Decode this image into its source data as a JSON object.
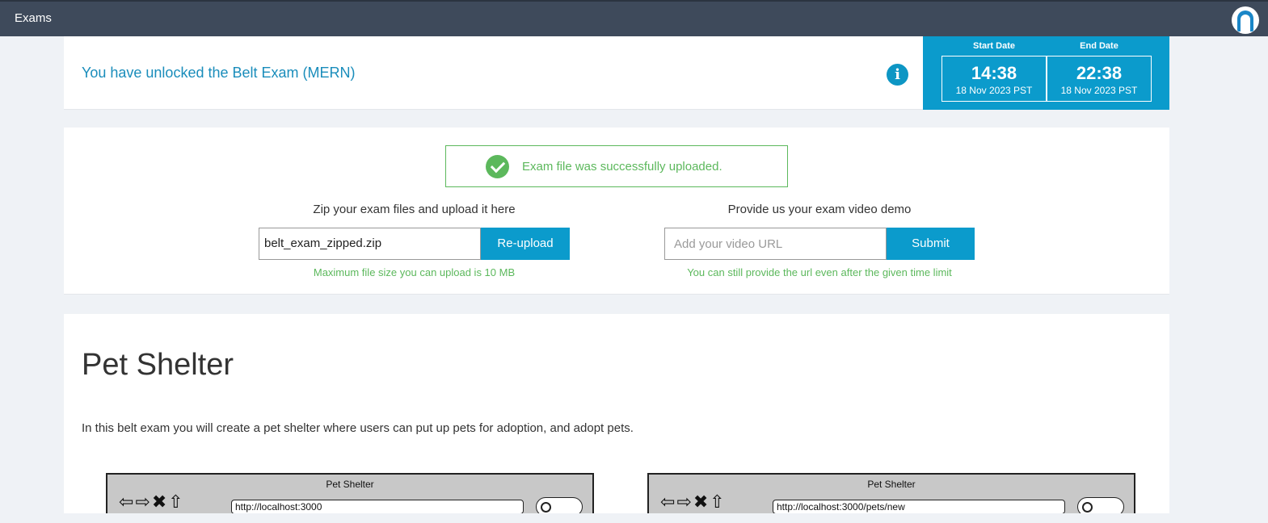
{
  "topbar": {
    "title": "Exams",
    "avatar_icon": "user-avatar-icon"
  },
  "exam": {
    "unlock_text": "You have unlocked the Belt Exam (MERN)",
    "info_icon": "info-icon",
    "start": {
      "label": "Start Date",
      "time": "14:38",
      "date": "18 Nov 2023 PST"
    },
    "end": {
      "label": "End Date",
      "time": "22:38",
      "date": "18 Nov 2023 PST"
    }
  },
  "upload": {
    "success_message": "Exam file was successfully uploaded.",
    "zip_label": "Zip your exam files and upload it here",
    "file_value": "belt_exam_zipped.zip",
    "reupload_label": "Re-upload",
    "file_hint": "Maximum file size you can upload is 10 MB",
    "video_label": "Provide us your exam video demo",
    "video_placeholder": "Add your video URL",
    "submit_label": "Submit",
    "video_hint": "You can still provide the url even after the given time limit"
  },
  "content": {
    "title": "Pet Shelter",
    "description": "In this belt exam you will create a pet shelter where users can put up pets for adoption, and adopt pets.",
    "wireframes": [
      {
        "title": "Pet Shelter",
        "url": "http://localhost:3000"
      },
      {
        "title": "Pet Shelter",
        "url": "http://localhost:3000/pets/new"
      }
    ]
  },
  "colors": {
    "accent": "#0b9bcc",
    "success": "#5cb85c",
    "topbar": "#3e4a5b"
  }
}
